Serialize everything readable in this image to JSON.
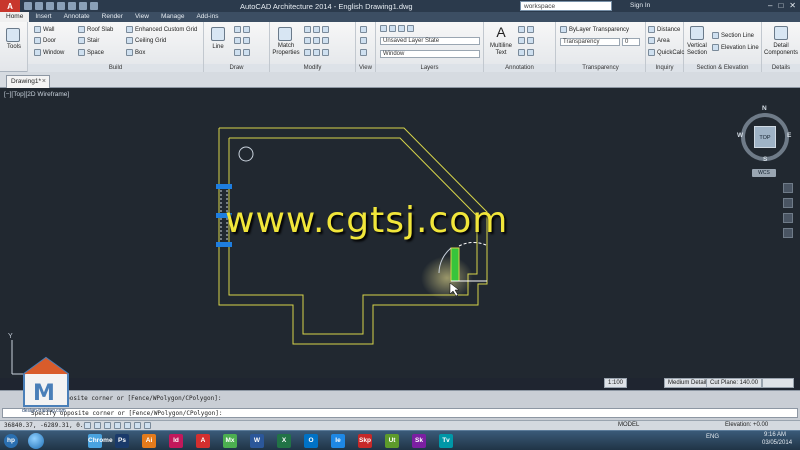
{
  "titlebar": {
    "app_button": "A",
    "title": "AutoCAD Architecture 2014 - English    Drawing1.dwg",
    "search_placeholder": "workspace",
    "signin": "Sign In"
  },
  "ribbon_tabs": [
    "Home",
    "Insert",
    "Annotate",
    "Render",
    "View",
    "Manage",
    "Add-ins"
  ],
  "ribbon": {
    "tools_label": "Tools",
    "build": {
      "title": "Build",
      "items": [
        "Wall",
        "Door",
        "Window",
        "Roof Slab",
        "Stair",
        "Space",
        "Enhanced Custom Grid",
        "Ceiling Grid",
        "Box"
      ]
    },
    "draw": {
      "title": "Draw",
      "line_label": "Line"
    },
    "modify": {
      "title": "Modify",
      "match_properties": "Match\nProperties"
    },
    "view": {
      "title": "View"
    },
    "layers": {
      "title": "Layers",
      "layer_state": "Unsaved Layer State",
      "layer_current": "Window"
    },
    "annotation": {
      "title": "Annotation",
      "multiline_text": "Multiline\nText"
    },
    "transparency": {
      "title": "Transparency",
      "bylayer": "ByLayer Transparency",
      "transparency_label": "Transparency",
      "transparency_value": "0"
    },
    "inquiry": {
      "title": "Inquiry",
      "distance": "Distance",
      "area": "Area",
      "quickcalc": "QuickCalc"
    },
    "section": {
      "title": "Section & Elevation",
      "vertical_section": "Vertical\nSection",
      "section_line": "Section Line",
      "elevation_line": "Elevation Line"
    },
    "details": {
      "detail_components": "Detail\nComponents",
      "title": "Details"
    }
  },
  "file_tab": {
    "label": "Drawing1*"
  },
  "viewport": {
    "label": "[−][Top][2D Wireframe]",
    "viewcube": {
      "top": "TOP",
      "n": "N",
      "s": "S",
      "e": "E",
      "w": "W",
      "wcs": "WCS"
    },
    "watermark": "www.cgtsj.com",
    "y_axis": "Y"
  },
  "status_mini": {
    "scale": "1:100",
    "detail": "Medium Detail",
    "cut_plane": "Cut Plane: 140.00"
  },
  "command_lines": [
    "Specify opposite corner or [Fence/WPolygon/CPolygon]:",
    "Specify opposite corner or [Fence/WPolygon/CPolygon]:"
  ],
  "logo_caption": "design-training.com",
  "statusbar": {
    "coords": "36840.37, -6289.31, 0.00",
    "model": "MODEL",
    "elevation": "Elevation: +0.00"
  },
  "taskbar": {
    "apps": [
      "Chrome",
      "Ps",
      "Ai",
      "Id",
      "A",
      "Mx",
      "W",
      "X",
      "O",
      "Ie",
      "Skp",
      "Ut",
      "Sk",
      "Tv"
    ],
    "language": "ENG",
    "time": "9:16 AM",
    "date": "03/05/2014"
  },
  "colors": {
    "drawing_line": "#d6d44a",
    "grip_blue": "#1e7ee0",
    "watermark": "#f1e63a",
    "canvas_bg": "#212830"
  }
}
